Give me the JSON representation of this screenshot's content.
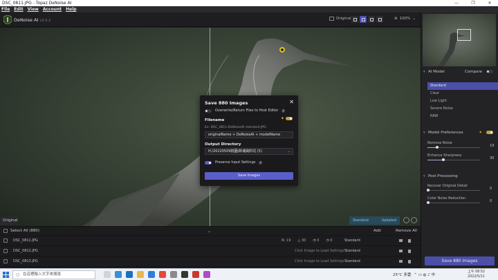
{
  "window": {
    "title": "DSC_0811.JPG - Topaz DeNoise AI",
    "controls": [
      "—",
      "❐",
      "✕"
    ]
  },
  "menu": [
    "File",
    "Edit",
    "View",
    "Account",
    "Help"
  ],
  "header": {
    "app_name": "DeNoise AI",
    "version": "v3.6.2",
    "view_label": "Original",
    "zoom": "100%"
  },
  "canvas": {
    "original_tag": "Original",
    "standard_label": "Standard",
    "updated_label": "Updated"
  },
  "file_list": {
    "select_all": "Select All (880)",
    "add": "Add",
    "remove_all": "Remove All",
    "rows": [
      {
        "name": "DSC_0811.JPG",
        "vals": [
          "19",
          "30",
          "0",
          "0"
        ],
        "hint": "",
        "model": "Standard"
      },
      {
        "name": "DSC_0812.JPG",
        "vals": [],
        "hint": "Click Image to Load Settings",
        "model": "Standard"
      },
      {
        "name": "DSC_0813.JPG",
        "vals": [],
        "hint": "Click Image to Load Settings",
        "model": "Standard"
      }
    ]
  },
  "right_panel": {
    "ai_model": "AI Model",
    "compare": "Compare",
    "models": [
      "Standard",
      "Clear",
      "Low Light",
      "Severe Noise",
      "RAW"
    ],
    "model_prefs": "Model Preferences",
    "remove_noise": "Remove Noise",
    "remove_noise_val": "19",
    "remove_noise_frac": 0.19,
    "enhance_sharpness": "Enhance Sharpness",
    "enhance_sharpness_val": "30",
    "enhance_sharpness_frac": 0.3,
    "post_processing": "Post Processing",
    "recover_detail": "Recover Original Detail",
    "recover_detail_val": "0",
    "color_noise": "Color Noise Reduction",
    "color_noise_val": "0",
    "save_button": "Save 880 Images"
  },
  "dialog": {
    "title": "Save 880 Images",
    "close": "✕",
    "overwrite_label": "Overwrite/Return Files to Host Editor",
    "filename_label": "Filename",
    "example": "Ex: DSC_0811-DeNoiseAI-standard.JPG",
    "filename_value": "originalName + DeNoiseAI + modelName",
    "output_label": "Output Directory",
    "output_value": "H:/20220509桃園/新埔窩料坑 (5)",
    "preserve_label": "Preserve Input Settings",
    "save_button": "Save Images"
  },
  "taskbar": {
    "search_placeholder": "在這裡輸入文字來搜尋",
    "weather": "25°C 多雲",
    "time": "上午 08:52",
    "date": "2022/5/11"
  }
}
